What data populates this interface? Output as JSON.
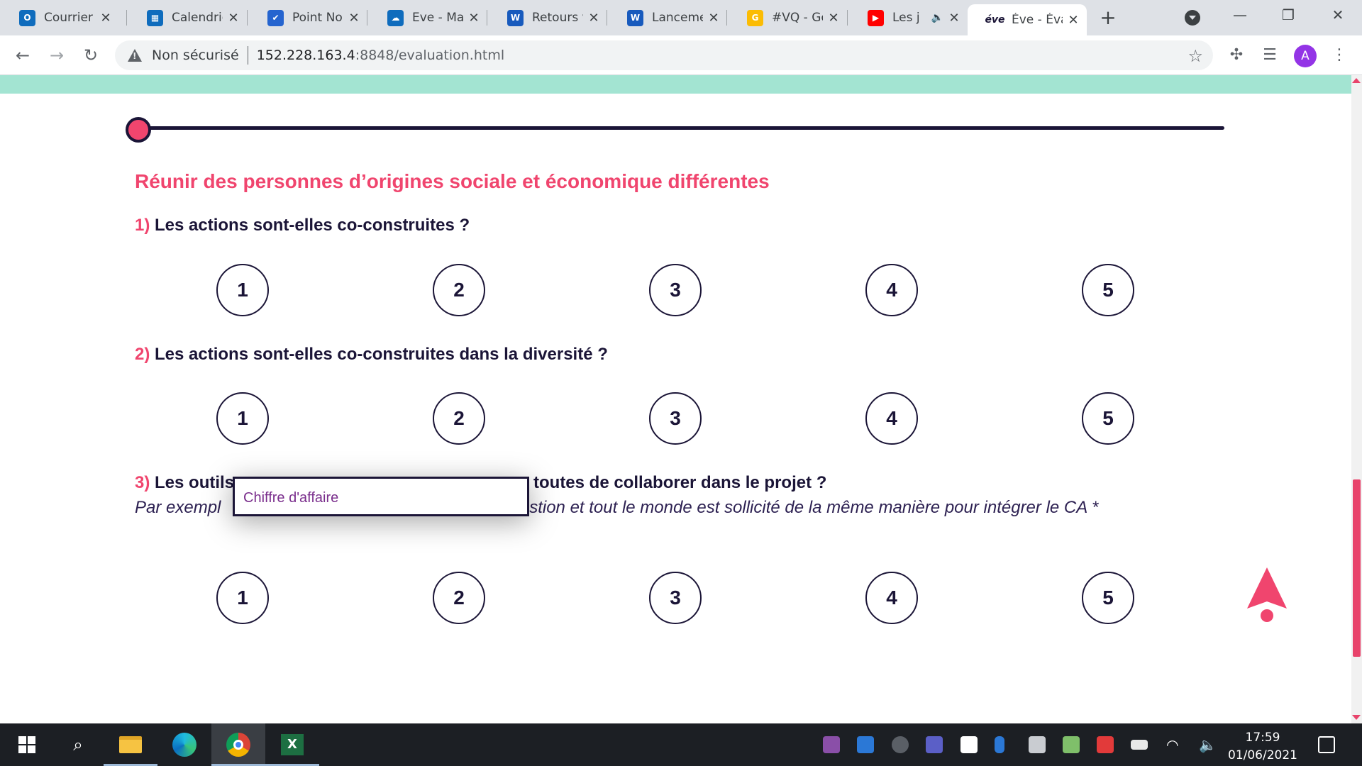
{
  "browser": {
    "tabs": [
      {
        "title": "Courrier",
        "icon": "outlook-icon",
        "color": "#0f6cbd",
        "glyph": "O"
      },
      {
        "title": "Calendrie",
        "icon": "calendar-icon",
        "color": "#0f6cbd",
        "glyph": "▦"
      },
      {
        "title": "Point No",
        "icon": "todo-icon",
        "color": "#2564cf",
        "glyph": "✔"
      },
      {
        "title": "Eve - Ma",
        "icon": "onedrive-icon",
        "color": "#0f6cbd",
        "glyph": "☁"
      },
      {
        "title": "Retours v",
        "icon": "word-icon",
        "color": "#185abd",
        "glyph": "W"
      },
      {
        "title": "Lanceme",
        "icon": "word-icon",
        "color": "#185abd",
        "glyph": "W"
      },
      {
        "title": "#VQ - Gc",
        "icon": "google-icon",
        "color": "#fbbc04",
        "glyph": "G"
      },
      {
        "title": "Les j",
        "icon": "youtube-icon",
        "color": "#ff0000",
        "glyph": "▶"
      },
      {
        "title": "Éve - Éva",
        "icon": "eve-icon",
        "color": "#1b1537",
        "glyph": "éve"
      }
    ],
    "address": {
      "security": "Non sécurisé",
      "host": "152.228.163.4",
      "rest": ":8848/evaluation.html"
    },
    "profile_initial": "A"
  },
  "page": {
    "section_title": "Réunir des personnes d’origines sociale et économique différentes",
    "questions": [
      {
        "number": "1)",
        "text": " Les actions sont-elles co-construites ?"
      },
      {
        "number": "2)",
        "text": " Les actions sont-elles co-construites dans la diversité ?"
      },
      {
        "number": "3)",
        "text": " Les outils",
        "text_after": " toutes de collaborer dans le projet ?"
      }
    ],
    "example": {
      "before": "Par exempl",
      "after": "ordée à cette question et tout le monde est sollicité de la même manière pour intégrer le CA *"
    },
    "ratings": [
      "1",
      "2",
      "3",
      "4",
      "5"
    ],
    "tooltip": "Chiffre d'affaire",
    "progress": 0.0
  },
  "taskbar": {
    "time": "17:59",
    "date": "01/06/2021"
  },
  "colors": {
    "accent_pink": "#f0456e",
    "navy": "#1b1537",
    "teal": "#a3e4d2"
  }
}
